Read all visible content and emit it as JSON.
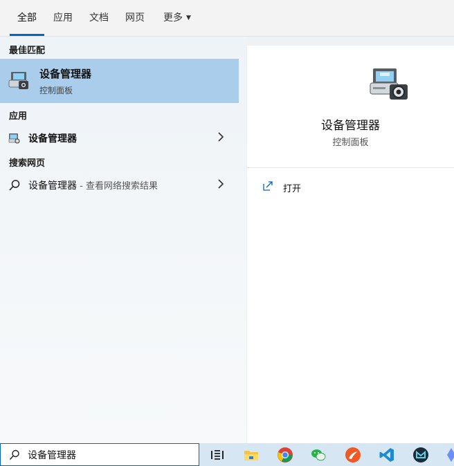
{
  "tabs": [
    {
      "label": "全部",
      "active": true
    },
    {
      "label": "应用",
      "active": false
    },
    {
      "label": "文档",
      "active": false
    },
    {
      "label": "网页",
      "active": false
    },
    {
      "label": "更多",
      "active": false
    }
  ],
  "sections": {
    "best_match": "最佳匹配",
    "apps": "应用",
    "web": "搜索网页"
  },
  "best_match": {
    "name": "设备管理器",
    "subtitle": "控制面板",
    "icon": "device-manager-icon"
  },
  "apps": [
    {
      "name": "设备管理器",
      "icon": "device-manager-icon"
    }
  ],
  "web": [
    {
      "name": "设备管理器",
      "suffix": " - 查看网络搜索结果",
      "icon": "search-icon"
    }
  ],
  "detail": {
    "title": "设备管理器",
    "subtitle": "控制面板",
    "actions": [
      {
        "label": "打开",
        "icon": "open-icon"
      }
    ]
  },
  "search": {
    "value": "设备管理器",
    "icon": "search-icon"
  },
  "taskbar": {
    "items": [
      "task-view-icon",
      "file-explorer-icon",
      "chrome-icon",
      "wechat-icon",
      "flag-app-icon",
      "vscode-icon",
      "app-m-icon",
      "app-partial-icon"
    ]
  },
  "colors": {
    "accent": "#0067c0",
    "selected": "#aacdec",
    "taskbar": "#d6e6f2"
  }
}
